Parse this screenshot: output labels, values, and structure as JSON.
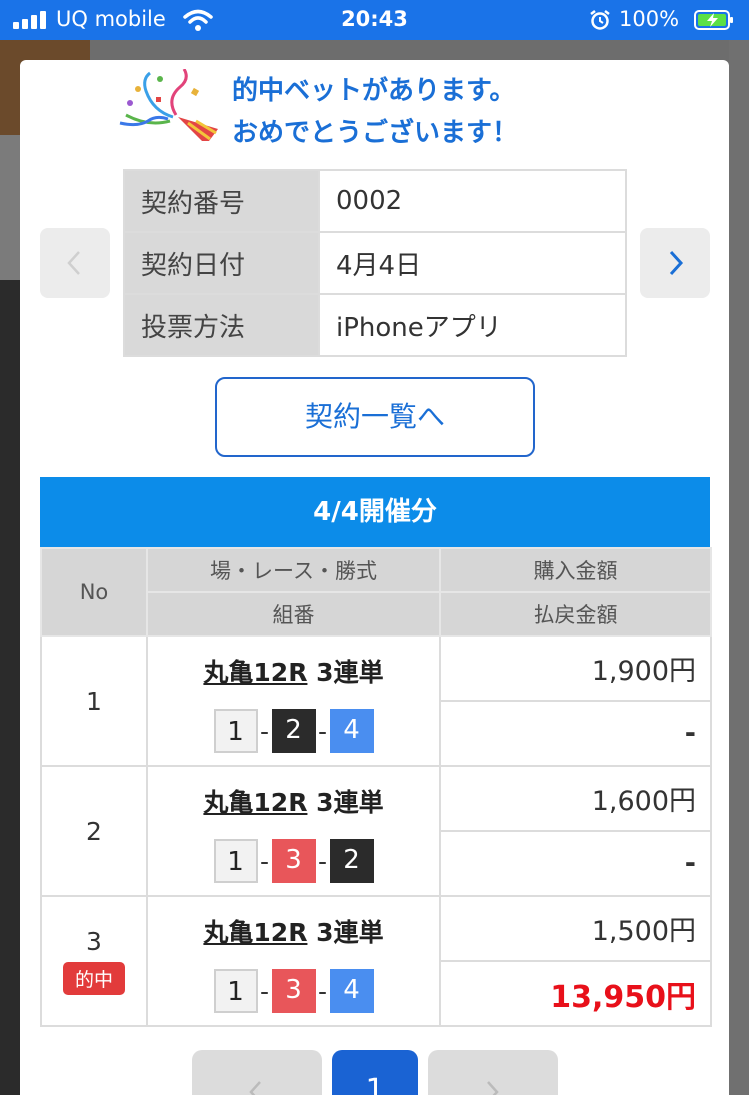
{
  "status_bar": {
    "carrier": "UQ mobile",
    "time": "20:43",
    "battery": "100%"
  },
  "modal": {
    "congrats_line1": "的中ベットがあります。",
    "congrats_line2": "おめでとうございます！",
    "contract": {
      "number_label": "契約番号",
      "number_value": "0002",
      "date_label": "契約日付",
      "date_value": "4月4日",
      "method_label": "投票方法",
      "method_value": "iPhoneアプリ"
    },
    "list_button": "契約一覧へ",
    "section_title": "4/4開催分",
    "table_headers": {
      "no": "No",
      "race": "場・レース・勝式",
      "combo": "組番",
      "purchase": "購入金額",
      "payout": "払戻金額"
    },
    "bets": [
      {
        "no": "1",
        "venue": "丸亀12R",
        "type": "3連単",
        "n1": "1",
        "n2": "2",
        "n3": "4",
        "purchase": "1,900円",
        "payout": "-"
      },
      {
        "no": "2",
        "venue": "丸亀12R",
        "type": "3連単",
        "n1": "1",
        "n2": "3",
        "n3": "2",
        "purchase": "1,600円",
        "payout": "-"
      },
      {
        "no": "3",
        "venue": "丸亀12R",
        "type": "3連単",
        "n1": "1",
        "n2": "3",
        "n3": "4",
        "purchase": "1,500円",
        "payout": "13,950円",
        "badge": "的中"
      }
    ],
    "pager_current": "1"
  },
  "colors": {
    "status_bar": "#1a73e8",
    "accent_blue": "#0c8ce9",
    "win_red": "#e8101a",
    "badge_red": "#e23b3b"
  }
}
